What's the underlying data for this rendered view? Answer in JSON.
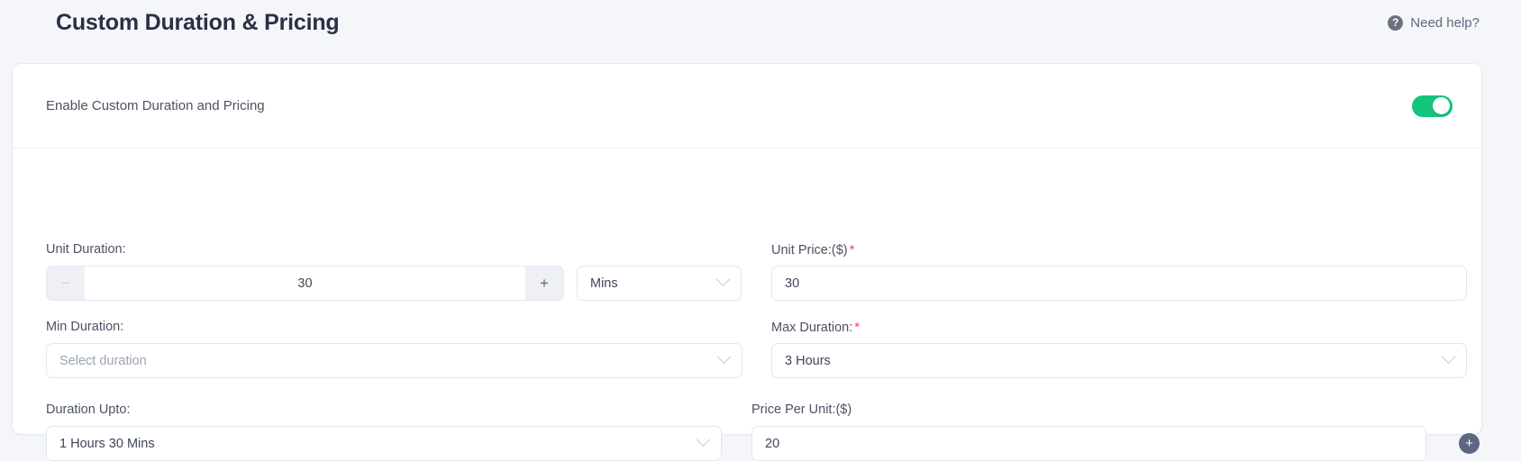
{
  "header": {
    "title": "Custom Duration & Pricing",
    "help": {
      "label": "Need help?",
      "icon": "question-mark-icon",
      "glyph": "?"
    }
  },
  "card": {
    "toggle_row": {
      "label": "Enable Custom Duration and Pricing",
      "enabled": true,
      "on_color": "#14c47d"
    },
    "fields": {
      "unit_duration": {
        "label": "Unit Duration:",
        "required": false,
        "value": "30",
        "decrement_glyph": "−",
        "increment_glyph": "+",
        "unit_select": {
          "value": "Mins",
          "icon": "chevron-down-icon"
        }
      },
      "unit_price": {
        "label": "Unit Price:($)",
        "required": true,
        "required_marker": "*",
        "value": "30"
      },
      "min_duration": {
        "label": "Min Duration:",
        "required": false,
        "value": "",
        "placeholder": "Select duration",
        "icon": "chevron-down-icon"
      },
      "max_duration": {
        "label": "Max Duration:",
        "required": true,
        "required_marker": "*",
        "value": "3 Hours",
        "icon": "chevron-down-icon"
      },
      "duration_upto": {
        "label": "Duration Upto:",
        "required": false,
        "value": "1 Hours 30 Mins",
        "icon": "chevron-down-icon"
      },
      "price_per_unit": {
        "label": "Price Per Unit:($)",
        "required": false,
        "value": "20"
      },
      "add_row_button": {
        "icon": "plus-circle-icon",
        "glyph": "+"
      }
    }
  },
  "colors": {
    "page_background": "#f4f6fa",
    "card_background": "#ffffff",
    "accent_green": "#14c47d",
    "required_red": "#f0435f",
    "add_button": "#5d6781",
    "title_text": "#2b2f45"
  }
}
